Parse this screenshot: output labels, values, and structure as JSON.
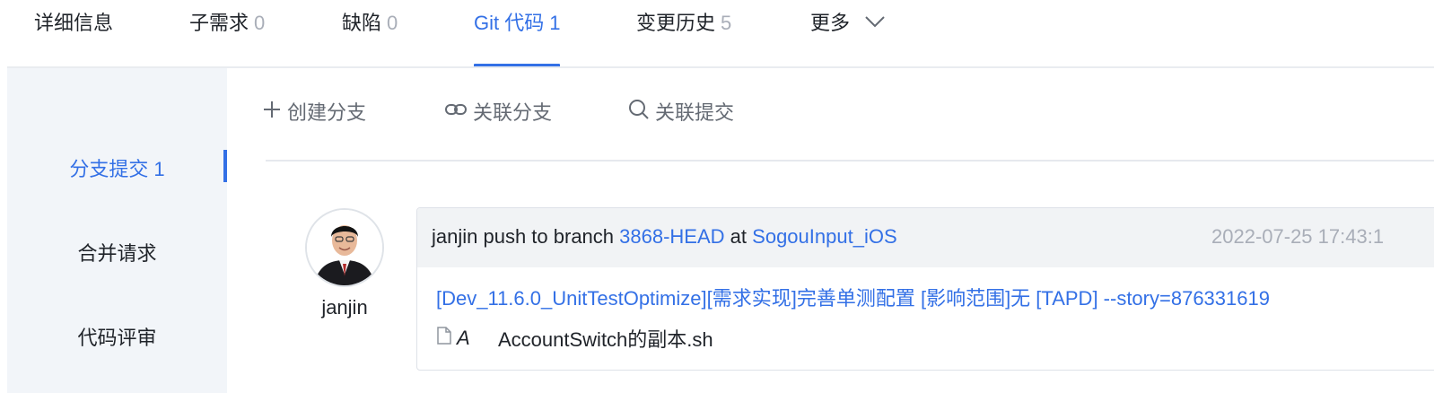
{
  "tabs": [
    {
      "label": "详细信息",
      "count": ""
    },
    {
      "label": "子需求",
      "count": "0"
    },
    {
      "label": "缺陷",
      "count": "0"
    },
    {
      "label": "Git 代码",
      "count": "1"
    },
    {
      "label": "变更历史",
      "count": "5"
    },
    {
      "label": "更多",
      "count": ""
    }
  ],
  "active_tab": "Git 代码",
  "sidebar": {
    "items": [
      {
        "label": "分支提交 1"
      },
      {
        "label": "合并请求"
      },
      {
        "label": "代码评审"
      }
    ]
  },
  "toolbar": {
    "create_branch": "创建分支",
    "link_branch": "关联分支",
    "link_commit": "关联提交"
  },
  "commit": {
    "author": "janjin",
    "action_text": "janjin push to branch",
    "branch": "3868-HEAD",
    "at_text": "at",
    "repo": "SogouInput_iOS",
    "time": "2022-07-25 17:43:1",
    "message": "[Dev_11.6.0_UnitTestOptimize][需求实现]完善单测配置 [影响范围]无 [TAPD] --story=876331619",
    "files": [
      {
        "change": "A",
        "name": "AccountSwitch的副本.sh"
      }
    ]
  },
  "colors": {
    "accent": "#3370e6",
    "sidebar_bg": "#f2f5f9",
    "card_header_bg": "#f1f3f5",
    "muted": "#a9aeb8"
  },
  "icons": [
    "plus-icon",
    "link-icon",
    "search-icon",
    "chevron-down-icon",
    "file-icon"
  ]
}
